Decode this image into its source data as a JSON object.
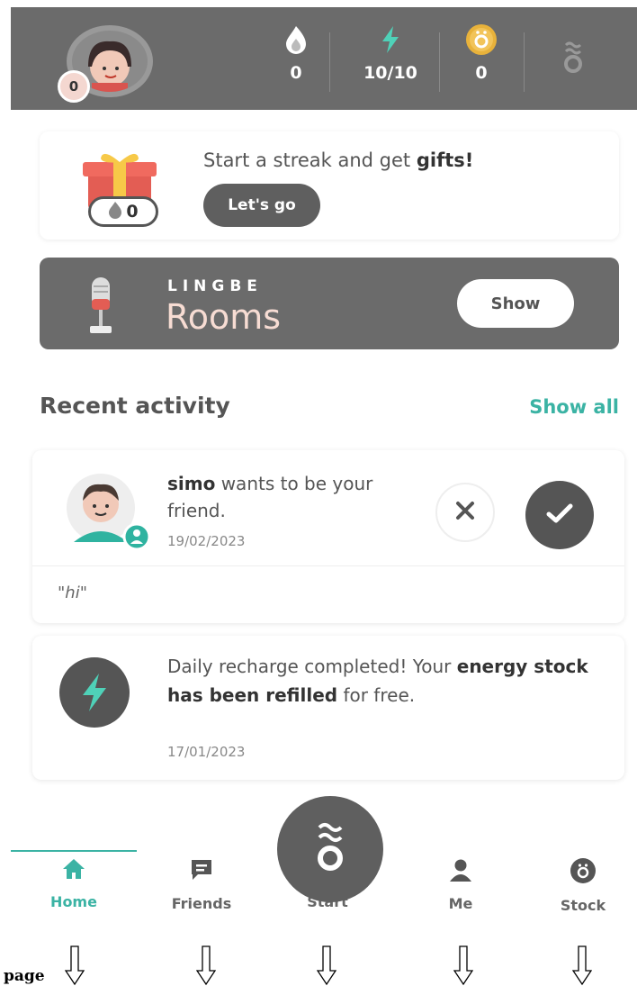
{
  "header": {
    "avatar_level": "0",
    "streak_count": "0",
    "energy": "10/10",
    "coins": "0"
  },
  "streak_card": {
    "text_prefix": "Start a streak and get ",
    "text_bold": "gifts!",
    "streak_value": "0",
    "button_label": "Let's go"
  },
  "rooms_card": {
    "brand": "LINGBE",
    "title": "Rooms",
    "button_label": "Show"
  },
  "recent_activity": {
    "title": "Recent activity",
    "show_all": "Show all",
    "friend_request": {
      "username": "simo",
      "message": " wants to be your friend.",
      "date": "19/02/2023",
      "quote": "\"hi\""
    },
    "recharge": {
      "text_prefix": "Daily recharge completed! Your ",
      "text_bold": "energy stock has been refilled",
      "text_suffix": " for free.",
      "date": "17/01/2023"
    }
  },
  "bottom_nav": {
    "items": [
      {
        "label": "Home",
        "icon": "home-icon",
        "active": true
      },
      {
        "label": "Friends",
        "icon": "chat-icon",
        "active": false
      },
      {
        "label": "Start",
        "icon": "lingbe-logo-icon",
        "active": false
      },
      {
        "label": "Me",
        "icon": "person-icon",
        "active": false
      },
      {
        "label": "Stock",
        "icon": "coin-icon",
        "active": false
      }
    ]
  },
  "annotation": {
    "page_label": "page"
  },
  "colors": {
    "accent": "#3bb3a4",
    "header_bg": "#6b6b6b",
    "dark_button": "#5f5f5f",
    "rooms_title": "#f7dcd3"
  }
}
